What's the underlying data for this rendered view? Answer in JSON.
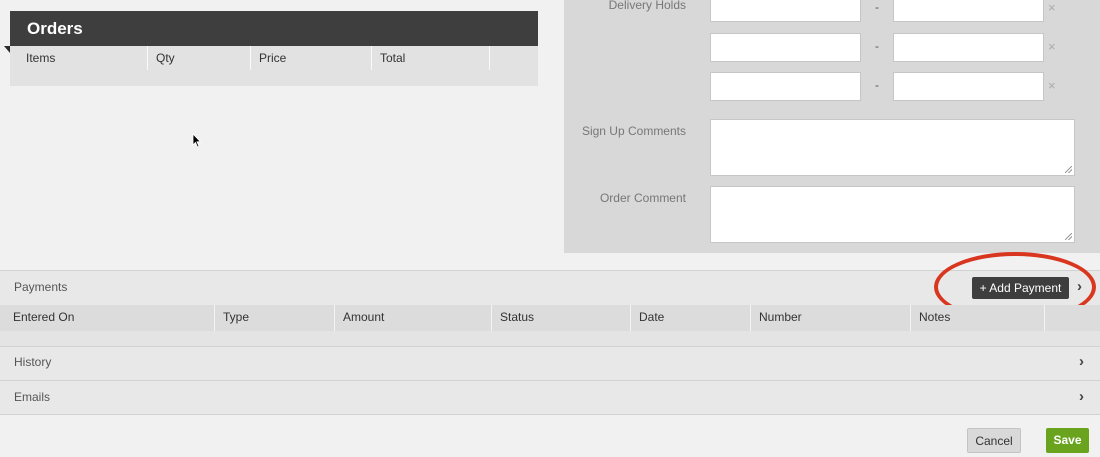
{
  "orders": {
    "title": "Orders",
    "columns": [
      "Items",
      "Qty",
      "Price",
      "Total"
    ]
  },
  "form": {
    "delivery_holds_label": "Delivery Holds",
    "dash": "-",
    "remove_icon": "×",
    "signup_comments_label": "Sign Up Comments",
    "order_comment_label": "Order Comment"
  },
  "payments": {
    "title": "Payments",
    "add_button": "+ Add Payment",
    "columns": [
      "Entered On",
      "Type",
      "Amount",
      "Status",
      "Date",
      "Number",
      "Notes"
    ]
  },
  "history": {
    "title": "History"
  },
  "emails": {
    "title": "Emails"
  },
  "chevron": "›",
  "footer": {
    "cancel": "Cancel",
    "save": "Save"
  },
  "colors": {
    "save": "#6aa41f",
    "highlight": "#d9361f",
    "dark": "#3e3e3e"
  }
}
